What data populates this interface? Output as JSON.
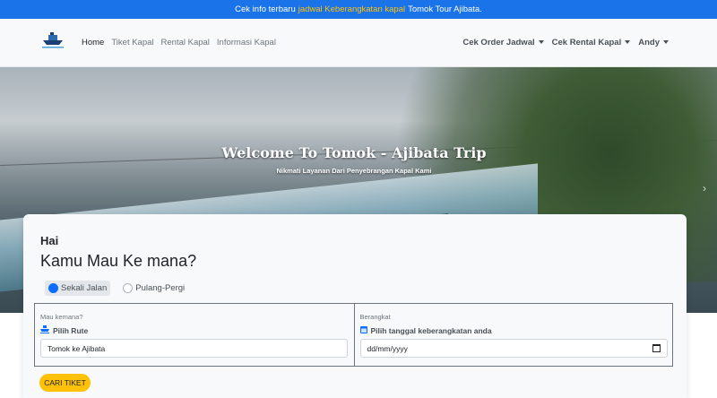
{
  "announcement": {
    "prefix": "Cek info terbaru",
    "link": "jadwal Keberangkatan kapal",
    "suffix": "Tomok Tour Ajibata."
  },
  "nav": {
    "links": [
      "Home",
      "Tiket Kapal",
      "Rental Kapal",
      "Informasi Kapal"
    ],
    "right": [
      "Cek Order Jadwal",
      "Cek Rental Kapal",
      "Andy"
    ]
  },
  "hero": {
    "title": "Welcome To Tomok - Ajibata Trip",
    "subtitle": "Nikmati Layanan Dari Penyebrangan Kapal Kami"
  },
  "search": {
    "greeting": "Hai",
    "question": "Kamu Mau Ke mana?",
    "trip_types": [
      "Sekali Jalan",
      "Pulang-Pergi"
    ],
    "selected_trip_type": "Sekali Jalan",
    "destination_label": "Mau kemana?",
    "route_label": "Pilih Rute",
    "route_value": "Tomok ke Ajibata",
    "depart_label": "Berangkat",
    "date_label": "Pilih tanggal keberangkatan anda",
    "date_placeholder": "dd/mm/yyyy",
    "submit_label": "CARI TIKET"
  },
  "colors": {
    "announcement_bg": "#1a73e8",
    "announcement_link": "#ffc107",
    "radio_selected": "#0d6efd",
    "button_bg": "#ffc107"
  },
  "icons": {
    "route": "ship-icon",
    "date": "calendar-icon"
  }
}
